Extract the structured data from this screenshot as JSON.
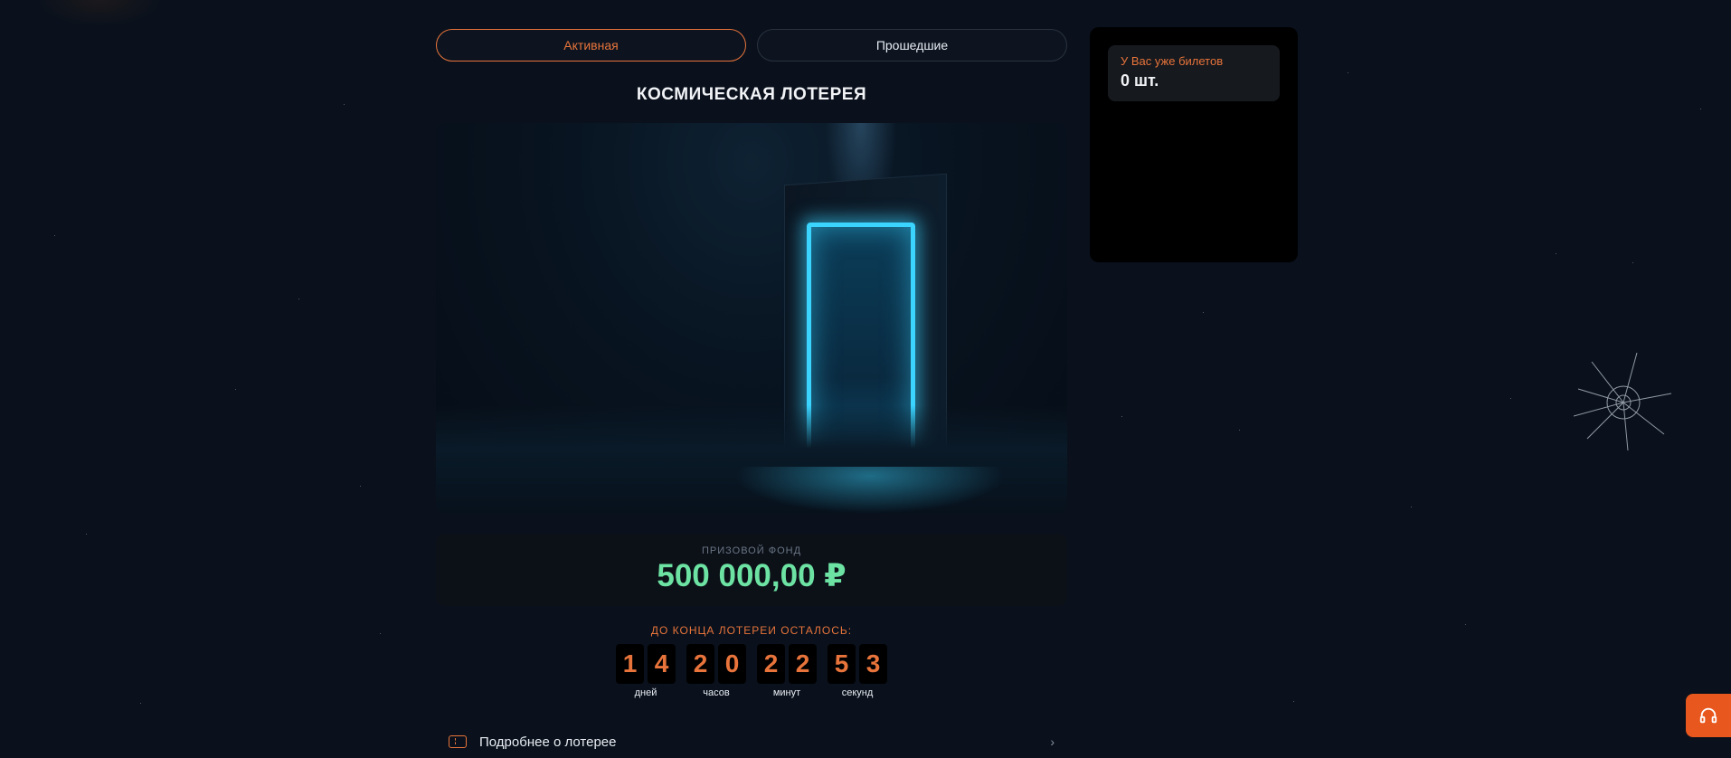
{
  "tabs": {
    "active_label": "Активная",
    "past_label": "Прошедшие"
  },
  "lottery": {
    "title": "КОСМИЧЕСКАЯ ЛОТЕРЕЯ",
    "prize_label": "ПРИЗОВОЙ ФОНД",
    "prize_value": "500 000,00 ₽",
    "countdown_title": "ДО КОНЦА ЛОТЕРЕИ ОСТАЛОСЬ:",
    "countdown": {
      "days": [
        "1",
        "4"
      ],
      "days_label": "дней",
      "hours": [
        "2",
        "0"
      ],
      "hours_label": "часов",
      "minutes": [
        "2",
        "2"
      ],
      "minutes_label": "минут",
      "seconds": [
        "5",
        "3"
      ],
      "seconds_label": "секунд"
    },
    "details_label": "Подробнее о лотерее"
  },
  "side": {
    "tickets_label": "У Вас уже билетов",
    "tickets_value": "0 шт."
  },
  "colors": {
    "accent": "#e8743b",
    "prize": "#6de3a3",
    "portal": "#3ad4ff",
    "support_button": "#e8571e"
  },
  "icons": {
    "details": "ticket-icon",
    "details_arrow": "chevron-right-icon",
    "support": "headset-icon"
  }
}
